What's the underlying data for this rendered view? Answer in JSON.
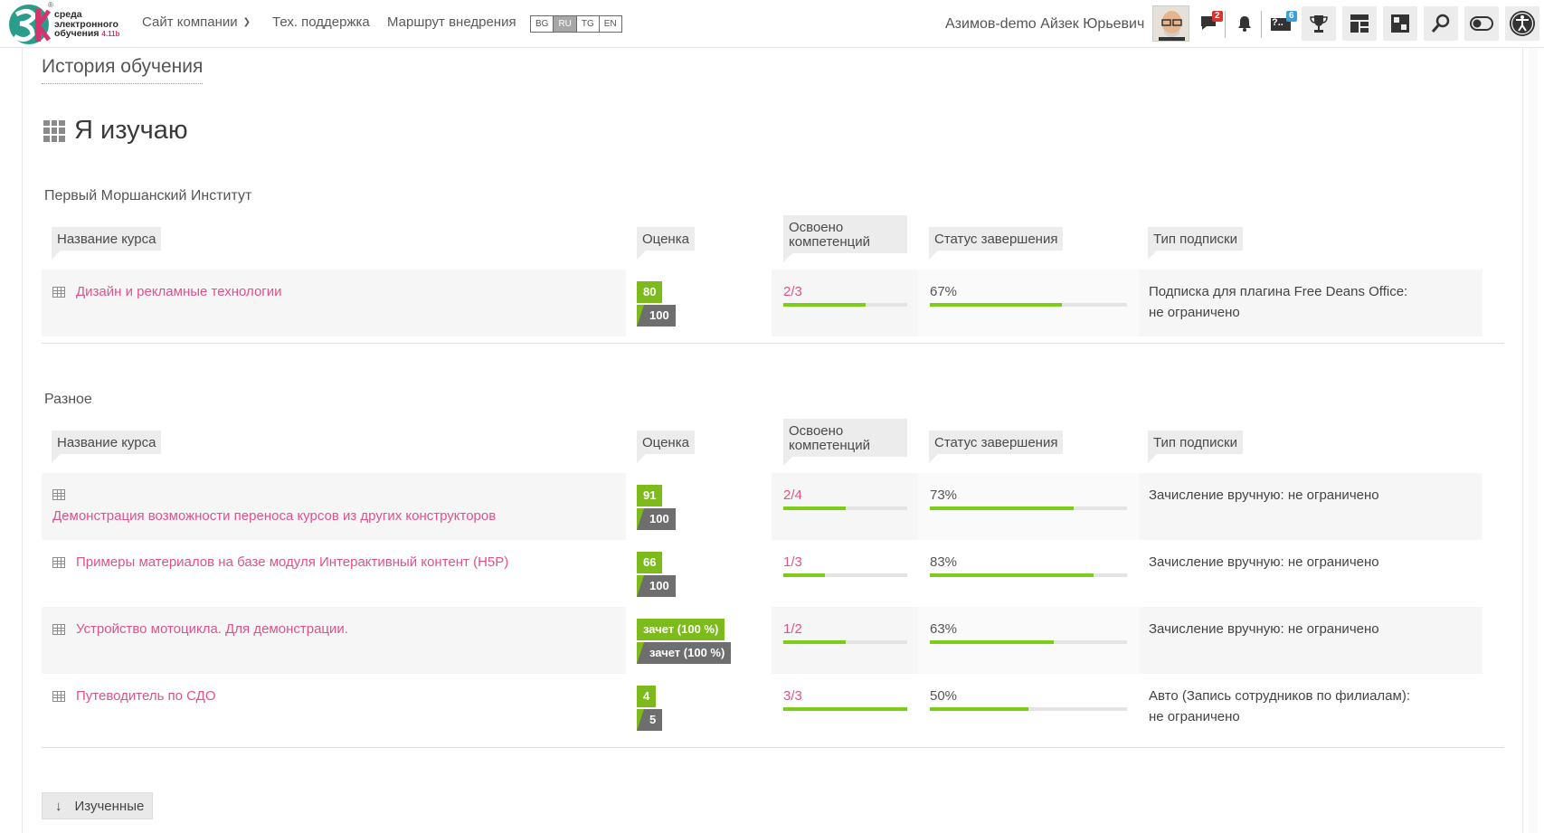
{
  "header": {
    "logo_text_line1": "среда",
    "logo_text_line2": "электронного",
    "logo_text_line3": "обучения",
    "logo_version": "4.11b",
    "logo_reg": "®",
    "logo_mark": "3К",
    "nav": [
      {
        "label": "Сайт компании",
        "dropdown": true
      },
      {
        "label": "Тех. поддержка"
      },
      {
        "label": "Маршрут внедрения"
      }
    ],
    "languages": [
      "BG",
      "RU",
      "TG",
      "EN"
    ],
    "active_language": "RU",
    "user_name": "Азимов-demo Айзек Юрьевич",
    "messages_count": "2",
    "help_count": "6",
    "help_label": "?..",
    "icons": [
      "messages-icon",
      "bell-icon",
      "help-icon",
      "trophy-icon",
      "dashboard-icon",
      "chess-icon",
      "search-icon",
      "toggle-icon",
      "accessibility-icon"
    ]
  },
  "breadcrumb": "История обучения",
  "page_title": "Я изучаю",
  "columns": {
    "course": "Название курса",
    "grade": "Оценка",
    "competencies_line1": "Освоено",
    "competencies_line2": "компетенций",
    "status": "Статус завершения",
    "subscription": "Тип подписки"
  },
  "sections": [
    {
      "title": "Первый Моршанский Институт",
      "courses": [
        {
          "name": "Дизайн и рекламные технологии",
          "grade": "80",
          "max": "100",
          "competencies": "2/3",
          "comp_fraction": 0.667,
          "status": "67%",
          "status_fraction": 0.67,
          "subscription_line1": "Подписка для плагина Free Deans Office:",
          "subscription_line2": "не ограничено"
        }
      ]
    },
    {
      "title": "Разное",
      "courses": [
        {
          "name": "Демонстрация возможности переноса курсов из других конструкторов",
          "grade": "91",
          "max": "100",
          "competencies": "2/4",
          "comp_fraction": 0.5,
          "status": "73%",
          "status_fraction": 0.73,
          "subscription_line1": "Зачисление вручную: не ограничено"
        },
        {
          "name": "Примеры материалов на базе модуля Интерактивный контент (H5P)",
          "grade": "66",
          "max": "100",
          "competencies": "1/3",
          "comp_fraction": 0.333,
          "status": "83%",
          "status_fraction": 0.83,
          "subscription_line1": "Зачисление вручную: не ограничено"
        },
        {
          "name": "Устройство мотоцикла. Для демонстрации.",
          "grade": "зачет (100 %)",
          "max": "зачет (100 %)",
          "competencies": "1/2",
          "comp_fraction": 0.5,
          "status": "63%",
          "status_fraction": 0.63,
          "subscription_line1": "Зачисление вручную: не ограничено"
        },
        {
          "name": "Путеводитель по СДО",
          "grade": "4",
          "max": "5",
          "competencies": "3/3",
          "comp_fraction": 1.0,
          "status": "50%",
          "status_fraction": 0.5,
          "subscription_line1": "Авто (Запись сотрудников по филиалам):",
          "subscription_line2": "не ограничено"
        }
      ]
    }
  ],
  "studied_button": "Изученные",
  "studied_arrow": "↓"
}
